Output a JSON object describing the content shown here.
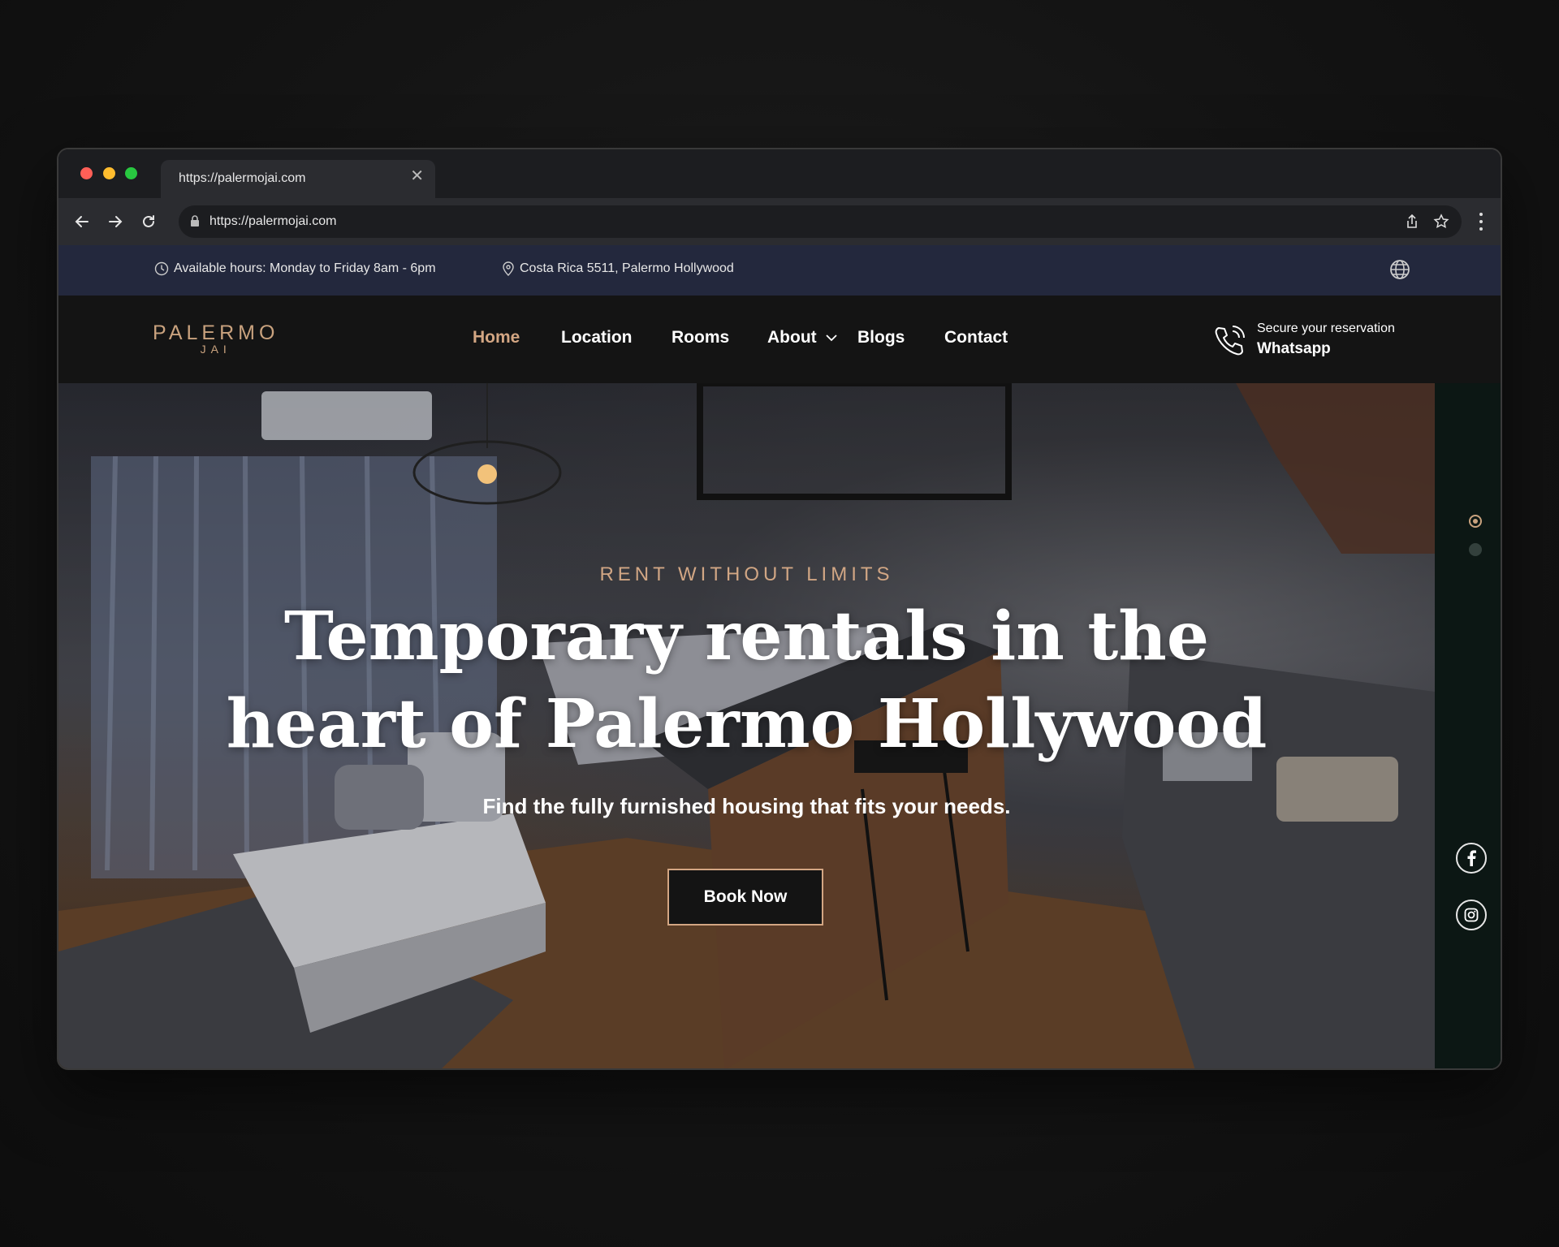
{
  "browser": {
    "tab_title": "https://palermojai.com",
    "url": "https://palermojai.com"
  },
  "infobar": {
    "hours": "Available hours: Monday to Friday 8am - 6pm",
    "address": "Costa Rica 5511, Palermo Hollywood"
  },
  "header": {
    "logo_main": "PALERMO",
    "logo_sub": "JAI",
    "nav": [
      {
        "label": "Home",
        "active": true
      },
      {
        "label": "Location",
        "active": false
      },
      {
        "label": "Rooms",
        "active": false
      },
      {
        "label": "About",
        "active": false
      },
      {
        "label": "Blogs",
        "active": false
      },
      {
        "label": "Contact",
        "active": false
      }
    ],
    "reserve_small": "Secure your reservation",
    "reserve_big": "Whatsapp"
  },
  "hero": {
    "eyebrow": "RENT WITHOUT LIMITS",
    "headline_line1": "Temporary rentals in the",
    "headline_line2": "heart of Palermo Hollywood",
    "subtitle": "Find the fully furnished housing that fits your needs.",
    "cta": "Book Now"
  },
  "colors": {
    "accent": "#d3a683",
    "infobar_bg": "#23283d",
    "header_bg": "#141414",
    "side_panel_bg": "#0c1714"
  },
  "icons": {
    "clock": "clock-icon",
    "pin": "location-pin-icon",
    "globe": "globe-icon",
    "phone": "phone-icon",
    "facebook": "facebook-icon",
    "instagram": "instagram-icon"
  }
}
